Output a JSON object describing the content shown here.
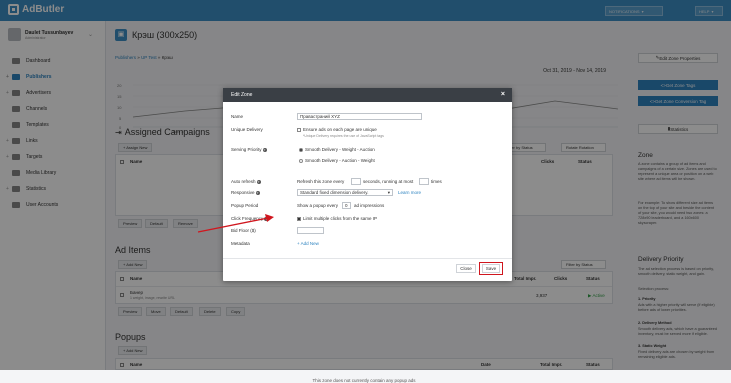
{
  "app": {
    "name": "AdButler"
  },
  "topbar": {
    "notifications_label": "NOTIFICATIONS",
    "help_label": "HELP"
  },
  "user": {
    "name": "Daulet Tussunbayev",
    "role": "Administrator"
  },
  "nav": [
    {
      "label": "Dashboard",
      "icon": "dashboard-icon",
      "expandable": false,
      "active": false
    },
    {
      "label": "Publishers",
      "icon": "publishers-icon",
      "expandable": true,
      "active": true
    },
    {
      "label": "Advertisers",
      "icon": "advertisers-icon",
      "expandable": true,
      "active": false
    },
    {
      "label": "Channels",
      "icon": "channels-icon",
      "expandable": false,
      "active": false
    },
    {
      "label": "Templates",
      "icon": "templates-icon",
      "expandable": false,
      "active": false
    },
    {
      "label": "Links",
      "icon": "links-icon",
      "expandable": true,
      "active": false
    },
    {
      "label": "Targets",
      "icon": "targets-icon",
      "expandable": true,
      "active": false
    },
    {
      "label": "Media Library",
      "icon": "media-library-icon",
      "expandable": false,
      "active": false
    },
    {
      "label": "Statistics",
      "icon": "statistics-icon",
      "expandable": true,
      "active": false
    },
    {
      "label": "User Accounts",
      "icon": "user-accounts-icon",
      "expandable": false,
      "active": false
    }
  ],
  "page": {
    "title": "Крэш (300x250)",
    "breadcrumb": {
      "publishers": "Publishers",
      "sep1": "»",
      "site": "UP Test",
      "sep2": "»",
      "current": "Крэш"
    },
    "date_range": "Oct 31, 2019 - Nov 14, 2019",
    "chart_ticks": {
      "y": [
        "20",
        "15",
        "10",
        "5",
        "0"
      ],
      "x": [
        "",
        "Nov 3",
        "Nov 8",
        ""
      ]
    }
  },
  "assigned": {
    "title": "Assigned Campaigns",
    "assign_btn": "+ Assign New",
    "filter": "Filter by Status",
    "rotation": "Rotate Rotation",
    "col_name": "Name",
    "col_clicks": "Clicks",
    "col_status": "Status",
    "actions": [
      "Preview",
      "Default",
      "Remove"
    ]
  },
  "ad_items": {
    "title": "Ad Items",
    "add_btn": "+ Add New",
    "filter": "Filter by Status",
    "col_name": "Name",
    "col_total": "Total Impr.",
    "col_clicks": "Clicks",
    "col_status": "Status",
    "row": {
      "name": "Банер",
      "sub": "1 weight, image, rewrite URL",
      "total": "3,937",
      "status": "Active"
    },
    "actions": [
      "Preview",
      "Move",
      "Default",
      "Delete",
      "Copy"
    ]
  },
  "popups": {
    "title": "Popups",
    "add_btn": "+ Add New",
    "col_name": "Name",
    "col_date": "Date",
    "col_total": "Total Impr.",
    "col_status": "Status",
    "empty": "This zone does not currently contain any popup ads"
  },
  "right": {
    "edit_btn": "Edit Zone Properties",
    "get_tags_btn": "Get Zone Tags",
    "conversion_btn": "Get Zone Conversion Tag",
    "stats_btn": "Statistics",
    "zone_title": "Zone",
    "zone_text": "A zone contains a group of ad items and campaigns of a certain size. Zones are used to represent a unique area or position on a web site where ad items will be shown.",
    "zone_example": "For example: To show different size ad items on the top of your site and beside the content of your site, you would need two zones: a 728x90 leaderboard, and a 160x600 skyscraper.",
    "priority_title": "Delivery Priority",
    "priority_text": "The ad selection process is based on priority, smooth delivery, static weight, and gain.",
    "priority_sub": "Selection process:",
    "p1_title": "1. Priority",
    "p1_text": "Ads with a higher priority will serve (if eligible) before ads of lower priorities.",
    "p2_title": "2. Delivery Method",
    "p2_text": "Smooth delivery ads, which have a guaranteed inventory, must be served more if eligible.",
    "p3_title": "3. Static Weight",
    "p3_text": "Fixed delivery ads are chosen by weight from remaining eligible ads."
  },
  "modal": {
    "title": "Edit Zone",
    "close": "×",
    "name_label": "Name",
    "name_value": "Правастраний XYZ",
    "unique_label": "Unique Delivery",
    "unique_text": "Ensure ads on each page are unique",
    "unique_note": "*Unique Delivery requires the use of JavaScript tags",
    "priority_label": "Serving Priority",
    "priority_opt1": "Smooth Delivery - Weight - Auction",
    "priority_opt2": "Smooth Delivery - Auction - Weight",
    "refresh_label": "Auto refresh",
    "refresh_a": "Refresh this zone every",
    "refresh_b": "seconds, running at most",
    "refresh_c": "times",
    "responsive_label": "Responsive",
    "responsive_value": "Standard fixed dimension delivery.",
    "learn_more": "Learn more",
    "popup_label": "Popup Period",
    "popup_a": "Show a popup every",
    "popup_value": "0",
    "popup_b": "ad impressions",
    "click_label": "Click Frequency",
    "click_text": "Limit multiple clicks from the same IP",
    "bid_label": "Bid Floor ($)",
    "meta_label": "Metadata",
    "meta_add": "+ Add New",
    "close_btn": "Close",
    "save_btn": "Save"
  },
  "colors": {
    "brand": "#3d8fc5",
    "highlight": "#d0161e",
    "active": "#2f9e44"
  }
}
